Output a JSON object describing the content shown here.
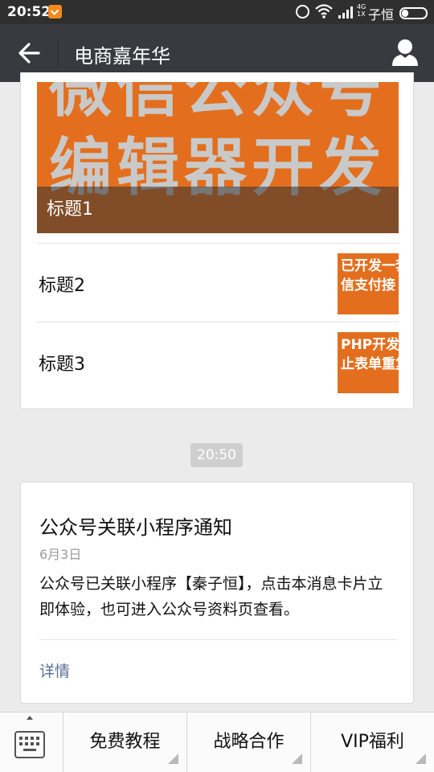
{
  "status_bar": {
    "time": "20:52",
    "network_top": "4G",
    "network_bottom": "1X",
    "carrier": "子恒"
  },
  "header": {
    "title": "电商嘉年华"
  },
  "article_card": {
    "cover_line1": "微信公众号",
    "cover_line2": "编辑器开发",
    "cover_title": "标题1",
    "items": [
      {
        "label": "标题2",
        "thumb_line1": "已开发一套",
        "thumb_line2": "信支付接"
      },
      {
        "label": "标题3",
        "thumb_line1": "PHP开发",
        "thumb_line2": "止表单重复提"
      }
    ]
  },
  "timestamp": "20:50",
  "notification": {
    "title": "公众号关联小程序通知",
    "date": "6月3日",
    "body": "公众号已关联小程序【秦子恒】，点击本消息卡片立即体验，也可进入公众号资料页查看。",
    "detail": "详情"
  },
  "menu": {
    "items": [
      "免费教程",
      "战略合作",
      "VIP福利"
    ]
  },
  "colors": {
    "header_bg": "#393a3f",
    "status_bg": "#2f2f2f",
    "cover_orange": "#e36f1e",
    "link_blue": "#5b6f8e"
  }
}
